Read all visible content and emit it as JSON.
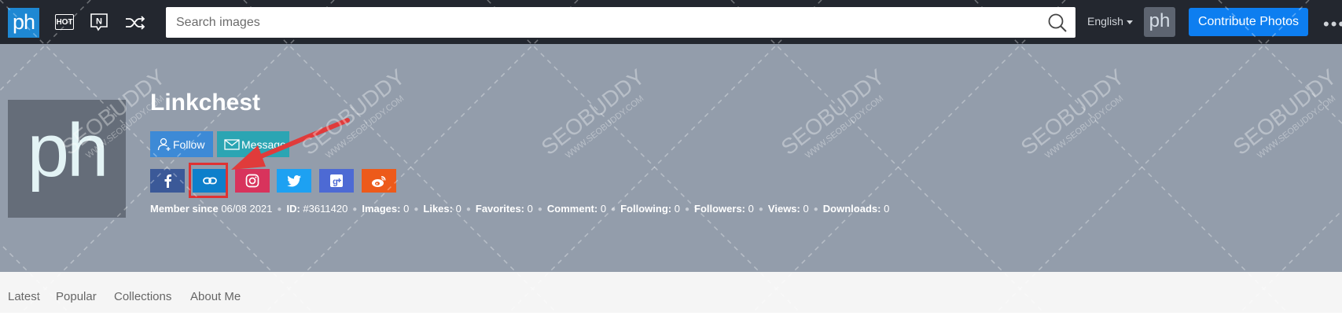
{
  "navbar": {
    "logo": "ph",
    "search_placeholder": "Search images",
    "language": "English",
    "avatar": "ph",
    "contribute_label": "Contribute Photos",
    "more": "•••",
    "icons": [
      "hot-icon",
      "new-icon",
      "shuffle-icon",
      "search-icon"
    ]
  },
  "profile": {
    "avatar": "ph",
    "username": "Linkchest",
    "follow_label": "Follow",
    "message_label": "Message",
    "social": [
      "facebook-icon",
      "link-icon",
      "instagram-icon",
      "twitter-icon",
      "google-plus-icon",
      "weibo-icon"
    ],
    "stats": [
      {
        "label": "Member since",
        "value": "06/08 2021"
      },
      {
        "label": "ID:",
        "value": "#3611420"
      },
      {
        "label": "Images:",
        "value": "0"
      },
      {
        "label": "Likes:",
        "value": "0"
      },
      {
        "label": "Favorites:",
        "value": "0"
      },
      {
        "label": "Comment:",
        "value": "0"
      },
      {
        "label": "Following:",
        "value": "0"
      },
      {
        "label": "Followers:",
        "value": "0"
      },
      {
        "label": "Views:",
        "value": "0"
      },
      {
        "label": "Downloads:",
        "value": "0"
      }
    ]
  },
  "tabs": [
    "Latest",
    "Popular",
    "Collections",
    "About Me"
  ],
  "watermark": {
    "brand": "SEOBUDDY",
    "url": "WWW.SEOBUDDY.COM"
  },
  "colors": {
    "navbar_bg": "#23272f",
    "cover_bg": "#939dab",
    "primary": "#0d7ef0",
    "highlight": "#e03232"
  }
}
